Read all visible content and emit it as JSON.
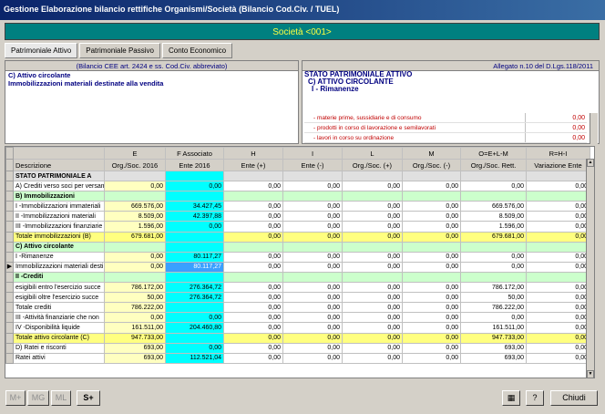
{
  "window": {
    "title": "Gestione Elaborazione bilancio rettifiche Organismi/Società (Bilancio Cod.Civ. / TUEL)"
  },
  "societa": "Società <001>",
  "tabs": [
    "Patrimoniale Attivo",
    "Patrimoniale Passivo",
    "Conto Economico"
  ],
  "left_panel": {
    "caption": "(Bilancio CEE art. 2424 e ss. Cod.Civ. abbreviato)",
    "line1": "C) Attivo circolante",
    "line2": "Immobilizzazioni materiali destinate alla vendita"
  },
  "right_panel": {
    "caption": "Allegato n.10 del D.Lgs.118/2011",
    "line1": "STATO PATRIMONIALE ATTIVO",
    "line2": "C) ATTIVO CIRCOLANTE",
    "line3": "I - Rimanenze",
    "rows": [
      {
        "desc": "- materie prime, sussidiarie e di consumo",
        "value": "0,00"
      },
      {
        "desc": "- prodotti in corso di lavorazione e semilavorati",
        "value": "0,00"
      },
      {
        "desc": "- lavori in corso su ordinazione",
        "value": "0,00"
      }
    ]
  },
  "grid": {
    "letters": [
      "E",
      "F Associato",
      "H",
      "I",
      "L",
      "M",
      "O=E+L-M",
      "R=H-I"
    ],
    "headers": [
      "Descrizione",
      "Org./Soc. 2016",
      "Ente 2016",
      "Ente (+)",
      "Ente (-)",
      "Org./Soc. (+)",
      "Org./Soc. (-)",
      "Org./Soc. Rett.",
      "Variazione Ente"
    ],
    "rows": [
      {
        "type": "grey",
        "desc": "STATO PATRIMONIALE A",
        "vals": [
          "",
          "",
          "",
          "",
          "",
          "",
          "",
          ""
        ]
      },
      {
        "type": "",
        "desc": "A) Crediti verso soci per versam",
        "vals": [
          "0,00",
          "0,00",
          "0,00",
          "0,00",
          "0,00",
          "0,00",
          "0,00",
          "0,00"
        ]
      },
      {
        "type": "sect",
        "desc": "B) Immobilizzazioni",
        "vals": [
          "",
          "",
          "",
          "",
          "",
          "",
          "",
          ""
        ]
      },
      {
        "type": "",
        "desc": "I -Immobilizzazioni immateriali",
        "vals": [
          "669.576,00",
          "34.427,45",
          "0,00",
          "0,00",
          "0,00",
          "0,00",
          "669.576,00",
          "0,00"
        ]
      },
      {
        "type": "",
        "desc": "II -Immobilizzazioni materiali",
        "vals": [
          "8.509,00",
          "42.397,88",
          "0,00",
          "0,00",
          "0,00",
          "0,00",
          "8.509,00",
          "0,00"
        ]
      },
      {
        "type": "",
        "desc": "III -Immobilizzazioni finanziarie",
        "vals": [
          "1.596,00",
          "0,00",
          "0,00",
          "0,00",
          "0,00",
          "0,00",
          "1.596,00",
          "0,00"
        ]
      },
      {
        "type": "tot",
        "desc": "Totale immobilizzazioni (B)",
        "vals": [
          "679.681,00",
          "",
          "0,00",
          "0,00",
          "0,00",
          "0,00",
          "679.681,00",
          "0,00"
        ]
      },
      {
        "type": "sect",
        "desc": "C) Attivo circolante",
        "vals": [
          "",
          "",
          "",
          "",
          "",
          "",
          "",
          ""
        ]
      },
      {
        "type": "",
        "desc": "I -Rimanenze",
        "vals": [
          "0,00",
          "80.117,27",
          "0,00",
          "0,00",
          "0,00",
          "0,00",
          "0,00",
          "0,00"
        ]
      },
      {
        "type": "cur",
        "desc": "Immobilizzazioni materiali desti",
        "vals": [
          "0,00",
          "80.117,27",
          "0,00",
          "0,00",
          "0,00",
          "0,00",
          "0,00",
          "0,00"
        ]
      },
      {
        "type": "sect",
        "desc": "II -Crediti",
        "vals": [
          "",
          "",
          "",
          "",
          "",
          "",
          "",
          ""
        ]
      },
      {
        "type": "",
        "desc": "esigibili entro l'esercizio succe",
        "vals": [
          "786.172,00",
          "276.364,72",
          "0,00",
          "0,00",
          "0,00",
          "0,00",
          "786.172,00",
          "0,00"
        ]
      },
      {
        "type": "",
        "desc": "esigibili oltre l'esercizio succe",
        "vals": [
          "50,00",
          "276.364,72",
          "0,00",
          "0,00",
          "0,00",
          "0,00",
          "50,00",
          "0,00"
        ]
      },
      {
        "type": "",
        "desc": "Totale crediti",
        "vals": [
          "786.222,00",
          "",
          "0,00",
          "0,00",
          "0,00",
          "0,00",
          "786.222,00",
          "0,00"
        ]
      },
      {
        "type": "",
        "desc": "III -Attività finanziarie che non",
        "vals": [
          "0,00",
          "0,00",
          "0,00",
          "0,00",
          "0,00",
          "0,00",
          "0,00",
          "0,00"
        ]
      },
      {
        "type": "",
        "desc": "IV -Disponibilità liquide",
        "vals": [
          "161.511,00",
          "204.460,80",
          "0,00",
          "0,00",
          "0,00",
          "0,00",
          "161.511,00",
          "0,00"
        ]
      },
      {
        "type": "tot",
        "desc": "Totale attivo circolante (C)",
        "vals": [
          "947.733,00",
          "",
          "0,00",
          "0,00",
          "0,00",
          "0,00",
          "947.733,00",
          "0,00"
        ]
      },
      {
        "type": "",
        "desc": "D) Ratei e risconti",
        "vals": [
          "693,00",
          "0,00",
          "0,00",
          "0,00",
          "0,00",
          "0,00",
          "693,00",
          "0,00"
        ]
      },
      {
        "type": "",
        "desc": "Ratei attivi",
        "vals": [
          "693,00",
          "112.521,04",
          "0,00",
          "0,00",
          "0,00",
          "0,00",
          "693,00",
          "0,00"
        ]
      }
    ]
  },
  "buttons": {
    "m_plus": "M+",
    "mg": "MG",
    "ml": "ML",
    "s_plus": "S+",
    "close": "Chiudi"
  },
  "icons": {
    "calc": "calculator-icon",
    "help": "help-icon"
  }
}
